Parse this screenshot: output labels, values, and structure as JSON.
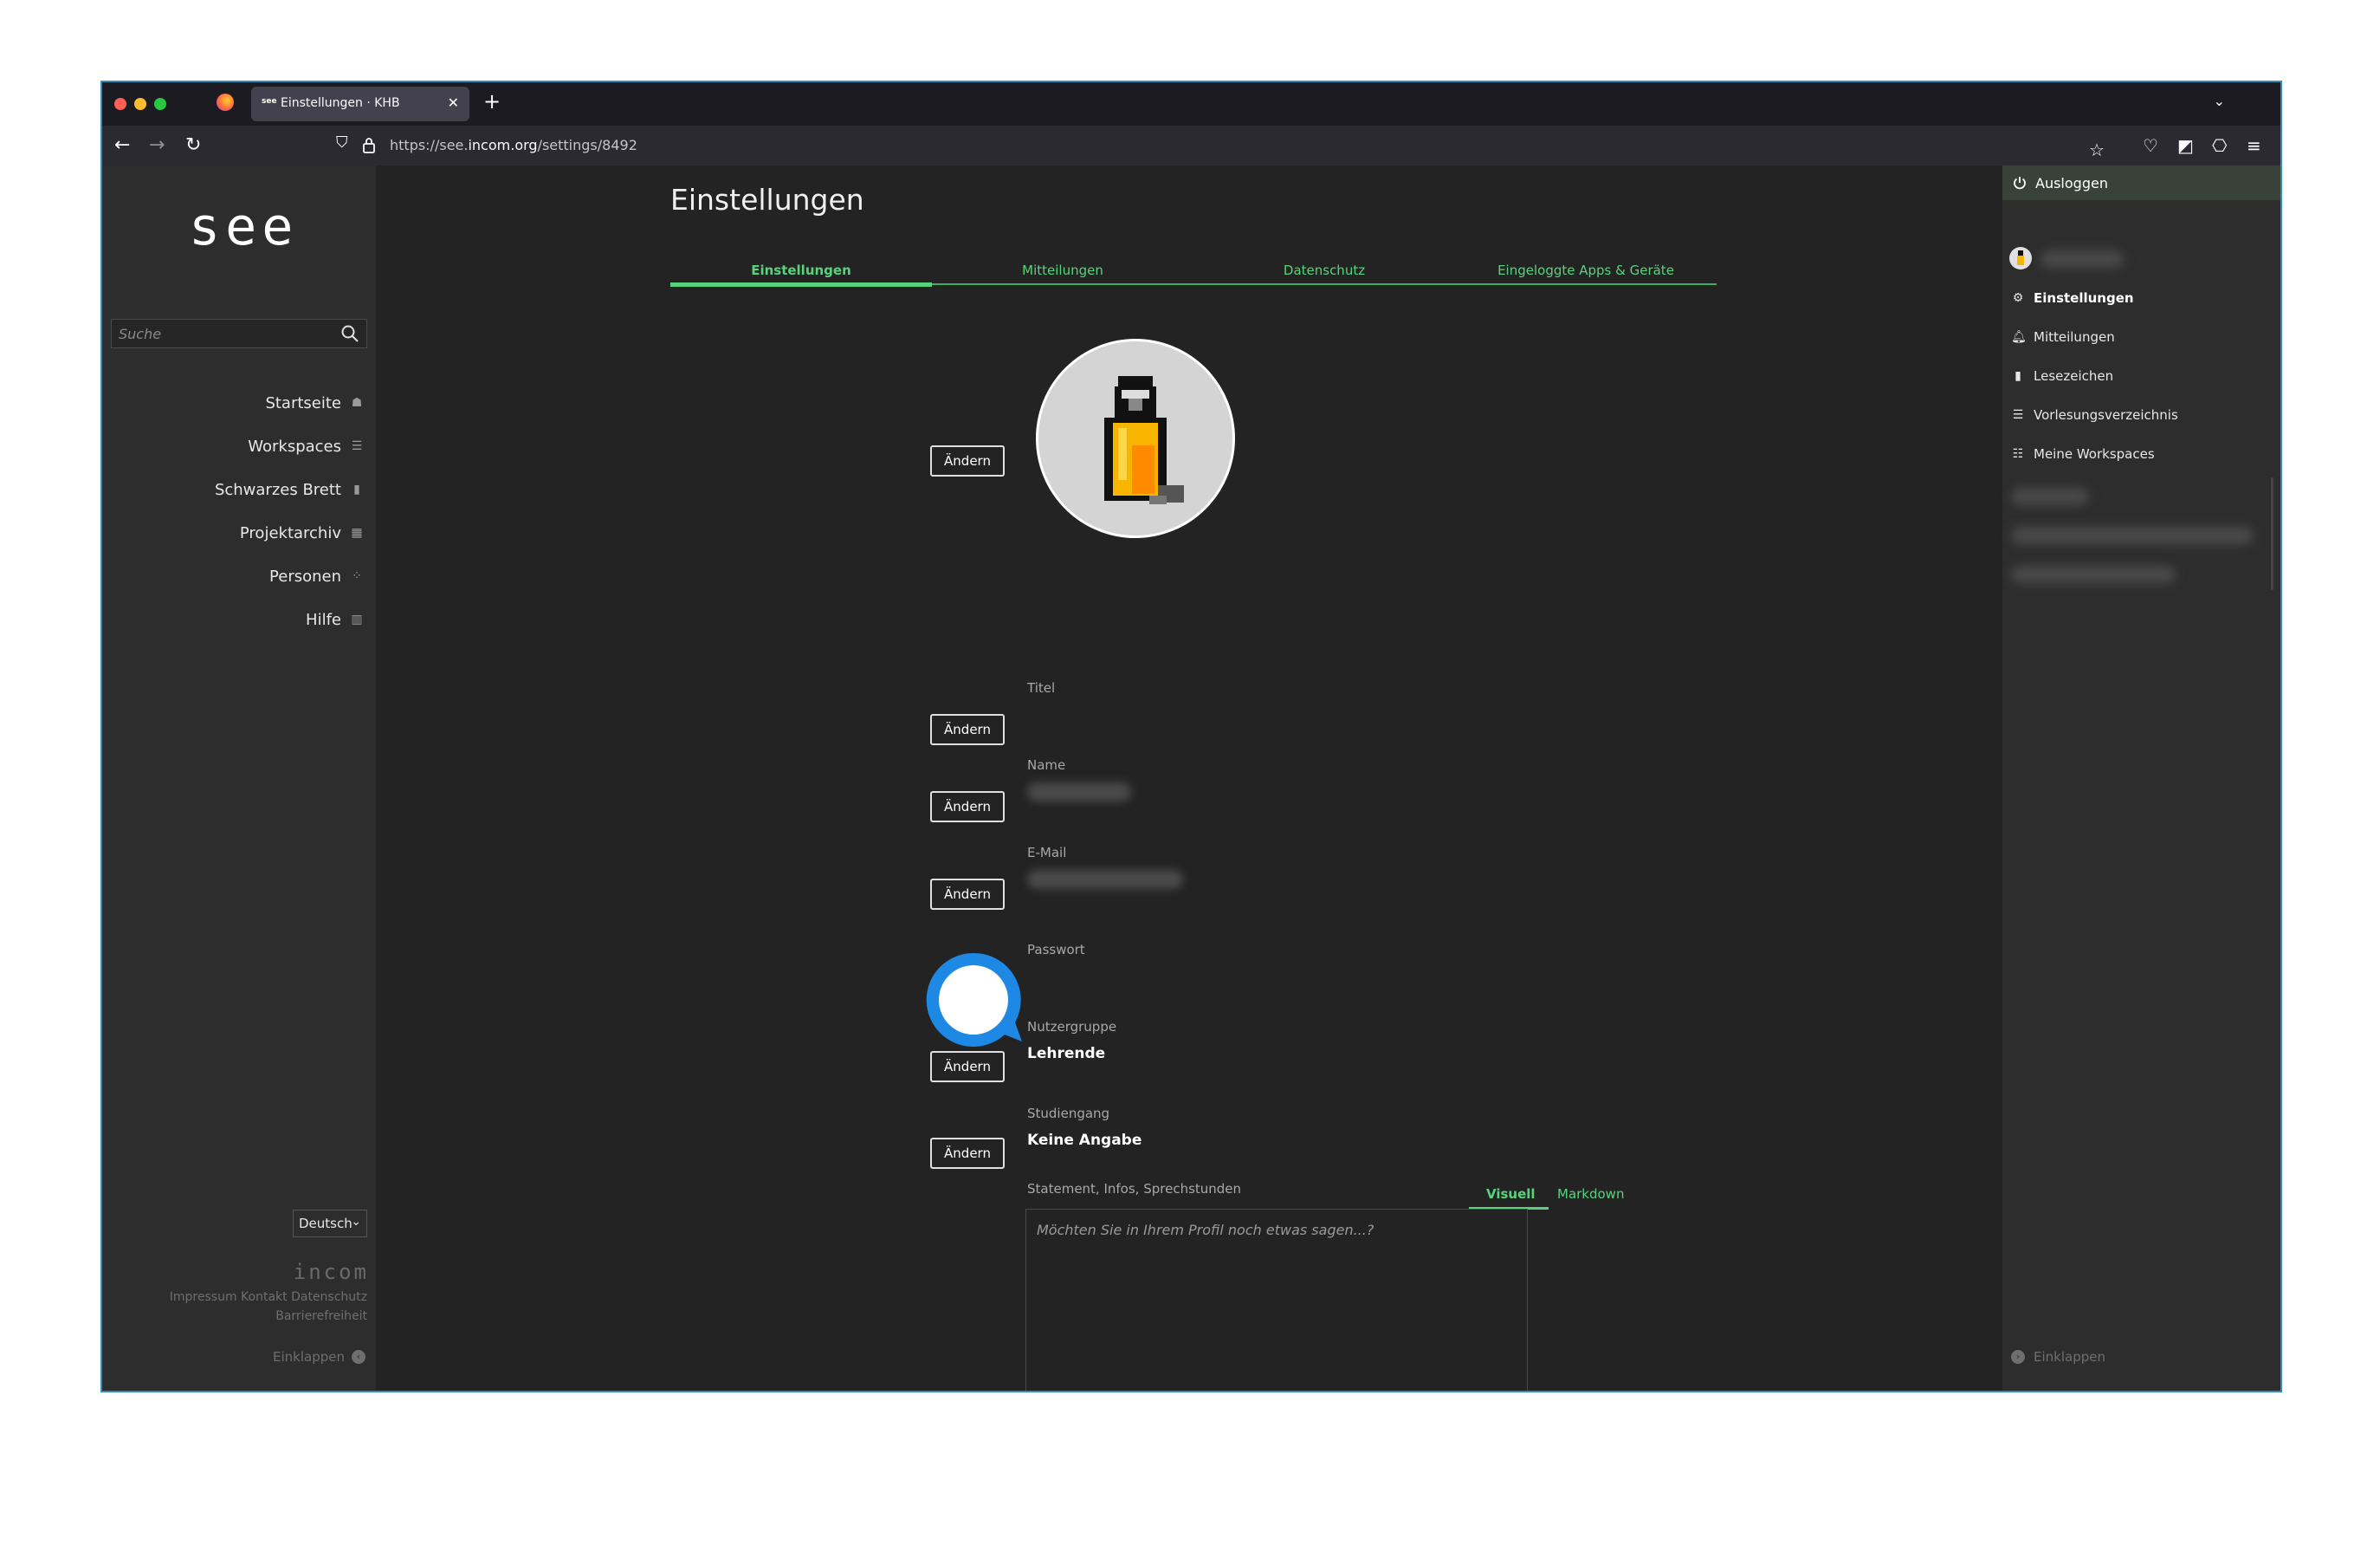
{
  "browser": {
    "tab_title": "Einstellungen · KHB",
    "tab_favicon": "see",
    "url_prefix": "https://see.",
    "url_domain": "incom.org",
    "url_path": "/settings/8492"
  },
  "leftnav": {
    "logo": "see",
    "search_placeholder": "Suche",
    "items": [
      {
        "label": "Startseite",
        "icon": "home-icon"
      },
      {
        "label": "Workspaces",
        "icon": "list-icon"
      },
      {
        "label": "Schwarzes Brett",
        "icon": "board-icon"
      },
      {
        "label": "Projektarchiv",
        "icon": "grid-icon"
      },
      {
        "label": "Personen",
        "icon": "people-icon"
      },
      {
        "label": "Hilfe",
        "icon": "book-icon"
      }
    ],
    "language": "Deutsch",
    "footer_logo": "incom",
    "footer_links_line1": "Impressum Kontakt Datenschutz",
    "footer_links_line2": "Barrierefreiheit",
    "collapse": "Einklappen"
  },
  "main": {
    "title": "Einstellungen",
    "tabs": [
      {
        "label": "Einstellungen",
        "active": true
      },
      {
        "label": "Mitteilungen"
      },
      {
        "label": "Datenschutz"
      },
      {
        "label": "Eingeloggte Apps & Geräte"
      }
    ],
    "change_label": "Ändern",
    "fields": {
      "title_label": "Titel",
      "name_label": "Name",
      "email_label": "E-Mail",
      "password_label": "Passwort",
      "usergroup_label": "Nutzergruppe",
      "usergroup_value": "Lehrende",
      "program_label": "Studiengang",
      "program_value": "Keine Angabe",
      "statement_label": "Statement, Infos, Sprechstunden"
    },
    "editor": {
      "mode_visual": "Visuell",
      "mode_markdown": "Markdown",
      "placeholder": "Möchten Sie in Ihrem Profil noch etwas sagen...?"
    }
  },
  "rightnav": {
    "logout": "Ausloggen",
    "items": [
      {
        "label": "Einstellungen",
        "icon": "gear-icon",
        "active": true
      },
      {
        "label": "Mitteilungen",
        "icon": "bell-icon"
      },
      {
        "label": "Lesezeichen",
        "icon": "bookmark-icon"
      },
      {
        "label": "Vorlesungsverzeichnis",
        "icon": "list-icon"
      },
      {
        "label": "Meine Workspaces",
        "icon": "list-icon"
      }
    ],
    "collapse": "Einklappen"
  },
  "colors": {
    "accent_green": "#58d37c",
    "sidebar_bg": "#2d2d2d",
    "main_bg": "#232323",
    "chat_blue": "#1e88e5"
  }
}
